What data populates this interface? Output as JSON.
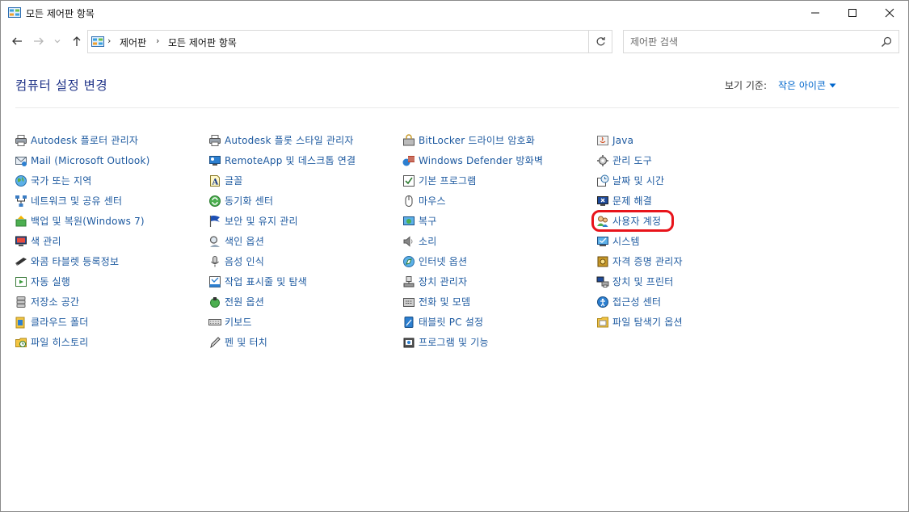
{
  "window": {
    "title": "모든 제어판 항목"
  },
  "nav": {
    "breadcrumbs": [
      "제어판",
      "모든 제어판 항목"
    ],
    "search_placeholder": "제어판 검색"
  },
  "header": {
    "title": "컴퓨터 설정 변경",
    "view_label": "보기 기준:",
    "view_value": "작은 아이콘"
  },
  "highlight_color": "#e8141b",
  "link_color": "#1e5aa0",
  "columns": [
    [
      {
        "label": "Autodesk 플로터 관리자",
        "icon": "printer-icon"
      },
      {
        "label": "Mail (Microsoft Outlook)",
        "icon": "mail-icon"
      },
      {
        "label": "국가 또는 지역",
        "icon": "globe-icon"
      },
      {
        "label": "네트워크 및 공유 센터",
        "icon": "network-icon"
      },
      {
        "label": "백업 및 복원(Windows 7)",
        "icon": "backup-icon"
      },
      {
        "label": "색 관리",
        "icon": "monitor-icon"
      },
      {
        "label": "와콤 타블렛 등록정보",
        "icon": "pen-tablet-icon"
      },
      {
        "label": "자동 실행",
        "icon": "autoplay-icon"
      },
      {
        "label": "저장소 공간",
        "icon": "storage-icon"
      },
      {
        "label": "클라우드 폴더",
        "icon": "cloud-folder-icon"
      },
      {
        "label": "파일 히스토리",
        "icon": "file-history-icon"
      }
    ],
    [
      {
        "label": "Autodesk 플롯 스타일 관리자",
        "icon": "printer-icon"
      },
      {
        "label": "RemoteApp 및 데스크톱 연결",
        "icon": "remote-desktop-icon"
      },
      {
        "label": "글꼴",
        "icon": "font-icon"
      },
      {
        "label": "동기화 센터",
        "icon": "sync-icon"
      },
      {
        "label": "보안 및 유지 관리",
        "icon": "flag-icon"
      },
      {
        "label": "색인 옵션",
        "icon": "indexing-icon"
      },
      {
        "label": "음성 인식",
        "icon": "microphone-icon"
      },
      {
        "label": "작업 표시줄 및 탐색",
        "icon": "taskbar-icon"
      },
      {
        "label": "전원 옵션",
        "icon": "power-icon"
      },
      {
        "label": "키보드",
        "icon": "keyboard-icon"
      },
      {
        "label": "펜 및 터치",
        "icon": "pen-icon"
      }
    ],
    [
      {
        "label": "BitLocker 드라이브 암호화",
        "icon": "bitlocker-icon"
      },
      {
        "label": "Windows Defender 방화벽",
        "icon": "firewall-icon"
      },
      {
        "label": "기본 프로그램",
        "icon": "default-programs-icon"
      },
      {
        "label": "마우스",
        "icon": "mouse-icon"
      },
      {
        "label": "복구",
        "icon": "recovery-icon"
      },
      {
        "label": "소리",
        "icon": "speaker-icon"
      },
      {
        "label": "인터넷 옵션",
        "icon": "internet-icon"
      },
      {
        "label": "장치 관리자",
        "icon": "device-manager-icon"
      },
      {
        "label": "전화 및 모뎀",
        "icon": "phone-modem-icon"
      },
      {
        "label": "태블릿 PC 설정",
        "icon": "tablet-icon"
      },
      {
        "label": "프로그램 및 기능",
        "icon": "programs-icon"
      }
    ],
    [
      {
        "label": "Java",
        "icon": "java-icon"
      },
      {
        "label": "관리 도구",
        "icon": "admin-tools-icon"
      },
      {
        "label": "날짜 및 시간",
        "icon": "clock-icon"
      },
      {
        "label": "문제 해결",
        "icon": "troubleshoot-icon"
      },
      {
        "label": "사용자 계정",
        "icon": "users-icon",
        "highlighted": true
      },
      {
        "label": "시스템",
        "icon": "system-icon"
      },
      {
        "label": "자격 증명 관리자",
        "icon": "credential-icon"
      },
      {
        "label": "장치 및 프린터",
        "icon": "devices-printers-icon"
      },
      {
        "label": "접근성 센터",
        "icon": "accessibility-icon"
      },
      {
        "label": "파일 탐색기 옵션",
        "icon": "folder-options-icon"
      }
    ]
  ]
}
